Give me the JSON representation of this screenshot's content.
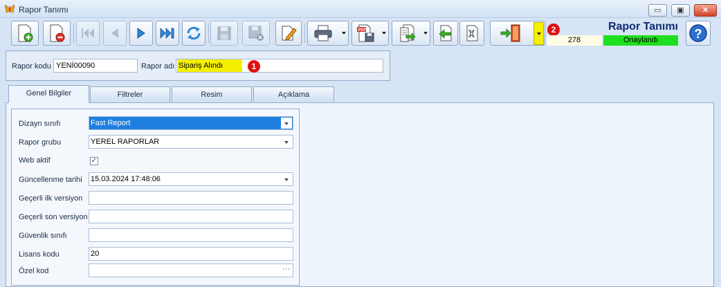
{
  "window": {
    "title": "Rapor Tanımı",
    "controls": {
      "minimize": "▭",
      "restore": "▣",
      "close": "✕"
    }
  },
  "toolbar": {
    "buttons": [
      {
        "name": "new-doc",
        "icon": "new-document-icon"
      },
      {
        "name": "delete-doc",
        "icon": "delete-document-icon"
      },
      {
        "name": "first",
        "icon": "first-record-icon"
      },
      {
        "name": "prev",
        "icon": "previous-record-icon"
      },
      {
        "name": "next",
        "icon": "next-record-icon"
      },
      {
        "name": "last",
        "icon": "last-record-icon"
      },
      {
        "name": "refresh",
        "icon": "refresh-icon"
      },
      {
        "name": "save",
        "icon": "save-icon"
      },
      {
        "name": "save-close",
        "icon": "save-close-icon"
      },
      {
        "name": "edit",
        "icon": "edit-pencil-icon"
      },
      {
        "name": "print",
        "icon": "printer-icon"
      },
      {
        "name": "pdf",
        "icon": "pdf-export-icon"
      },
      {
        "name": "export",
        "icon": "export-icon"
      },
      {
        "name": "back",
        "icon": "back-document-icon"
      },
      {
        "name": "tools",
        "icon": "tools-icon"
      },
      {
        "name": "exit",
        "icon": "exit-door-icon"
      },
      {
        "name": "help",
        "icon": "help-icon"
      }
    ],
    "exit_dropdown_color": "#f5f000"
  },
  "header": {
    "title": "Rapor Tanımı",
    "record_number": "278",
    "status": "Onaylandı",
    "status_color": "#1ee01e"
  },
  "badges": {
    "first": "1",
    "second": "2"
  },
  "report": {
    "code_label": "Rapor kodu",
    "code_value": "YENİ00090",
    "name_label": "Rapor adı",
    "name_value": "Sipariş Alındı",
    "name_highlight": "#f5f000"
  },
  "tabs": [
    {
      "label": "Genel Bilgiler",
      "active": true
    },
    {
      "label": "Filtreler",
      "active": false
    },
    {
      "label": "Resim",
      "active": false
    },
    {
      "label": "Açıklama",
      "active": false
    }
  ],
  "general": {
    "fields": [
      {
        "label": "Dizayn sınıfı",
        "value": "Fast Report",
        "type": "combo-selected"
      },
      {
        "label": "Rapor grubu",
        "value": "YEREL RAPORLAR",
        "type": "combo"
      },
      {
        "label": "Web aktif",
        "value": "✓",
        "type": "checkbox"
      },
      {
        "label": "Güncellenme tarihi",
        "value": "15.03.2024 17:48:06",
        "type": "combo"
      },
      {
        "label": "Geçerli ilk versiyon",
        "value": "",
        "type": "text"
      },
      {
        "label": "Geçerli son versiyon",
        "value": "",
        "type": "text"
      },
      {
        "label": "Güvenlik sınıfı",
        "value": "",
        "type": "text"
      },
      {
        "label": "Lisans kodu",
        "value": "20",
        "type": "text"
      },
      {
        "label": "Özel kod",
        "value": "",
        "type": "ellipsis"
      }
    ],
    "ellipsis": "···"
  }
}
